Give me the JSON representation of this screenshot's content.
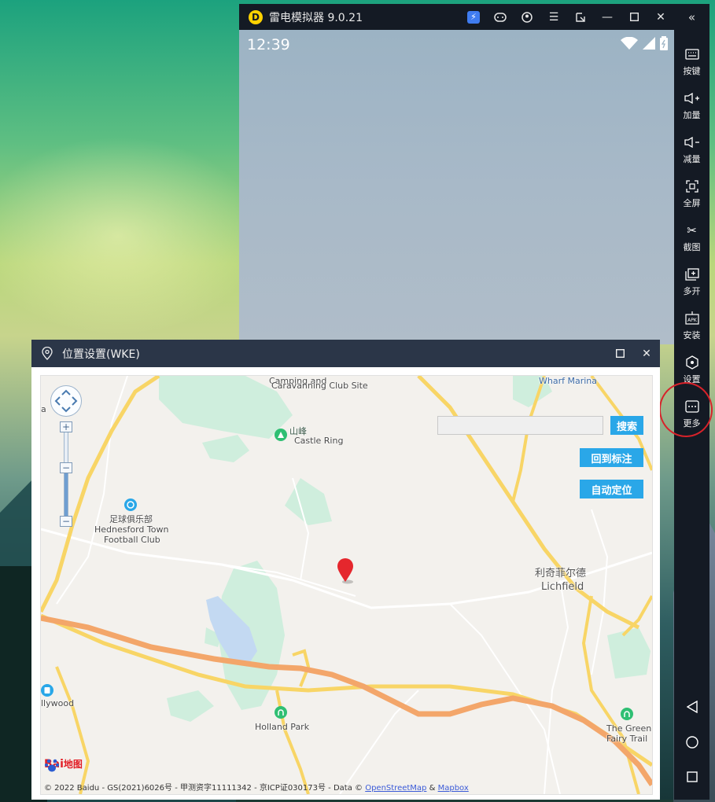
{
  "emulator": {
    "title": "雷电模拟器 9.0.21",
    "status_time": "12:39",
    "sidebar": [
      {
        "label": "按键",
        "icon": "keyboard-icon"
      },
      {
        "label": "加量",
        "icon": "volume-up-icon"
      },
      {
        "label": "减量",
        "icon": "volume-down-icon"
      },
      {
        "label": "全屏",
        "icon": "fullscreen-icon"
      },
      {
        "label": "截图",
        "icon": "scissors-icon"
      },
      {
        "label": "多开",
        "icon": "multi-instance-icon"
      },
      {
        "label": "安装",
        "icon": "apk-icon"
      },
      {
        "label": "设置",
        "icon": "gear-icon"
      },
      {
        "label": "更多",
        "icon": "more-icon"
      }
    ],
    "annotation_color": "#d8222a"
  },
  "dialog": {
    "title": "位置设置(WKE)",
    "search_button": "搜索",
    "return_button": "回到标注",
    "auto_locate_button": "自动定位",
    "search_value": ""
  },
  "map": {
    "labels": {
      "camping_top": "Camping and",
      "camping_bottom": "Caravanning Club Site",
      "wharf": "Wharf Marina",
      "castle_zh": "山峰",
      "castle_en": "Castle Ring",
      "club_zh": "足球俱乐部",
      "club_en1": "Hednesford Town",
      "club_en2": "Football Club",
      "lichfield_zh": "利奇菲尔德",
      "lichfield_en": "Lichfield",
      "holland": "Holland Park",
      "fairy1": "The Green",
      "fairy2": "Fairy Trail",
      "hollywood": "llywood",
      "edge_a": "a"
    },
    "logo_text_1": "Bai",
    "logo_text_2": "地图",
    "copyright_text": "© 2022 Baidu - GS(2021)6026号 - 甲测资字11111342 - 京ICP证030173号 - Data ©",
    "osm_link": "OpenStreetMap",
    "amp": "&",
    "mapbox_link": "Mapbox"
  }
}
